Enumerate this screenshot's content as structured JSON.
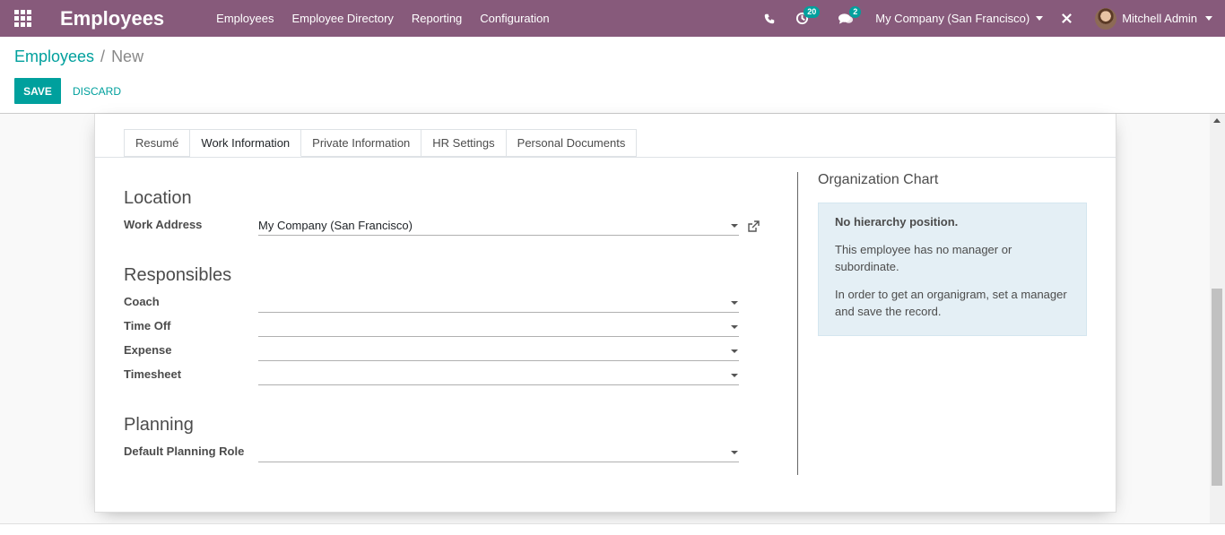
{
  "app": {
    "name": "Employees"
  },
  "navbar": {
    "menu": [
      "Employees",
      "Employee Directory",
      "Reporting",
      "Configuration"
    ],
    "activities_count": "20",
    "messages_count": "2",
    "company": "My Company (San Francisco)",
    "user": "Mitchell Admin",
    "accent": "#875a7b"
  },
  "breadcrumb": {
    "parent": "Employees",
    "separator": "/",
    "current": "New"
  },
  "buttons": {
    "save": "SAVE",
    "discard": "DISCARD"
  },
  "tabs": [
    "Resumé",
    "Work Information",
    "Private Information",
    "HR Settings",
    "Personal Documents"
  ],
  "active_tab": "Work Information",
  "form": {
    "location": {
      "title": "Location",
      "work_address_label": "Work Address",
      "work_address_value": "My Company (San Francisco)"
    },
    "responsibles": {
      "title": "Responsibles",
      "coach_label": "Coach",
      "time_off_label": "Time Off",
      "expense_label": "Expense",
      "timesheet_label": "Timesheet"
    },
    "planning": {
      "title": "Planning",
      "role_label": "Default Planning Role"
    }
  },
  "org_chart": {
    "title": "Organization Chart",
    "heading": "No hierarchy position.",
    "line1": "This employee has no manager or subordinate.",
    "line2": "In order to get an organigram, set a manager and save the record."
  },
  "icons": [
    "apps-icon",
    "phone-icon",
    "activity-clock-icon",
    "chat-icon",
    "close-icon",
    "external-link-icon",
    "chevron-down-icon"
  ]
}
